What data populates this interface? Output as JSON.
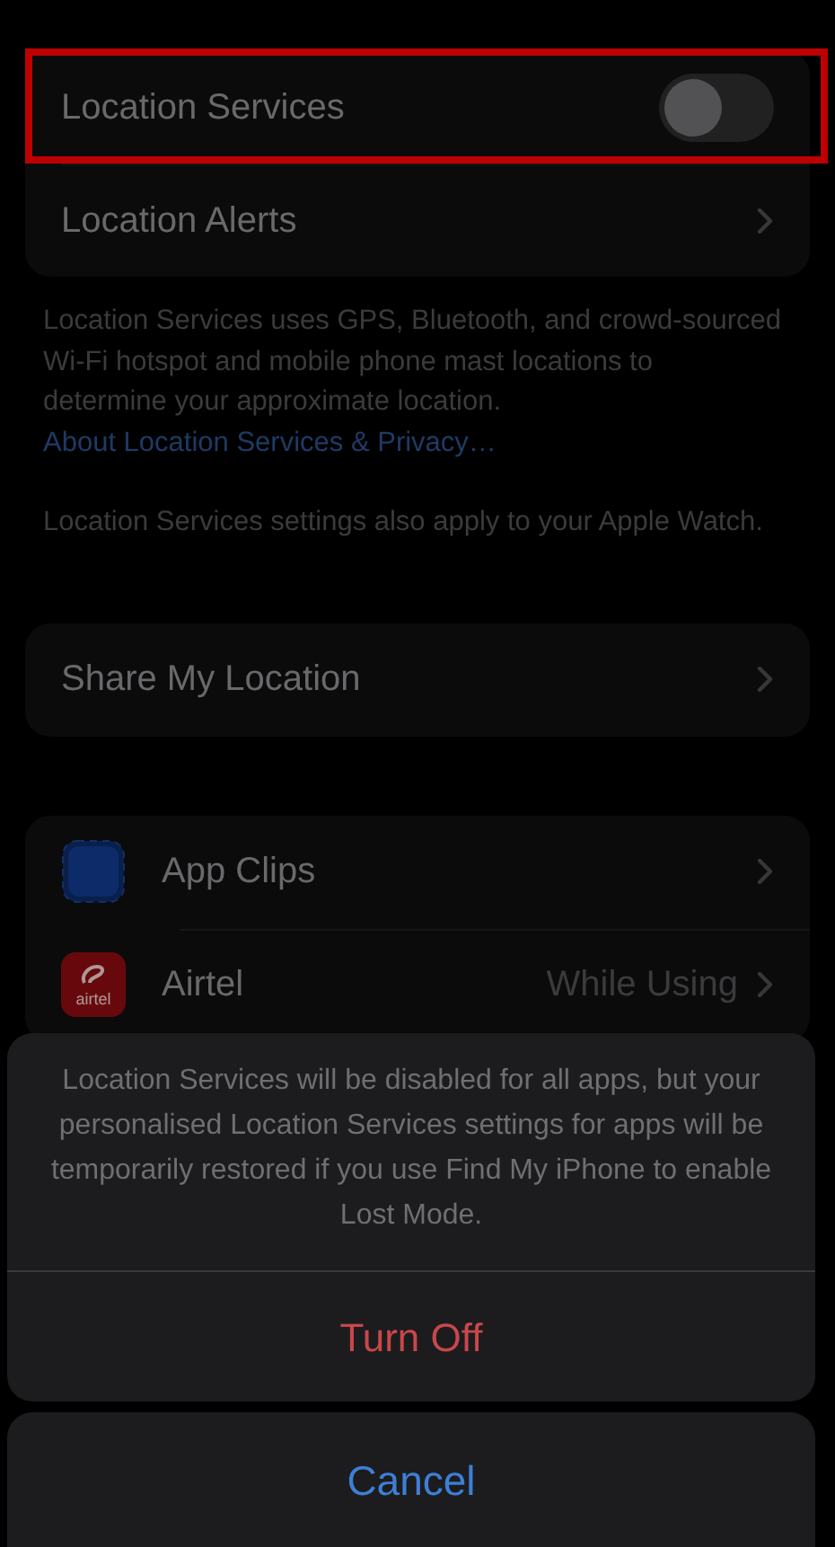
{
  "location_group": [
    {
      "kind": "toggle",
      "label": "Location Services",
      "on": false,
      "highlighted": true
    },
    {
      "kind": "link",
      "label": "Location Alerts",
      "highlighted": false
    }
  ],
  "footer": {
    "text": "Location Services uses GPS, Bluetooth, and crowd-sourced Wi-Fi hotspot and mobile phone mast locations to determine your approximate location.",
    "link": "About Location Services & Privacy…",
    "note": "Location Services settings also apply to your Apple Watch."
  },
  "share_group": [
    {
      "label": "Share My Location"
    }
  ],
  "apps": [
    {
      "name": "App Clips",
      "kind": "clips"
    },
    {
      "name": "Airtel",
      "kind": "airtel",
      "icon_text": "airtel",
      "value": "While Using"
    }
  ],
  "action_sheet": {
    "message": "Location Services will be disabled for all apps, but your personalised Location Services settings for apps will be temporarily restored if you use Find My iPhone to enable Lost Mode.",
    "destructive": "Turn Off",
    "cancel": "Cancel"
  }
}
